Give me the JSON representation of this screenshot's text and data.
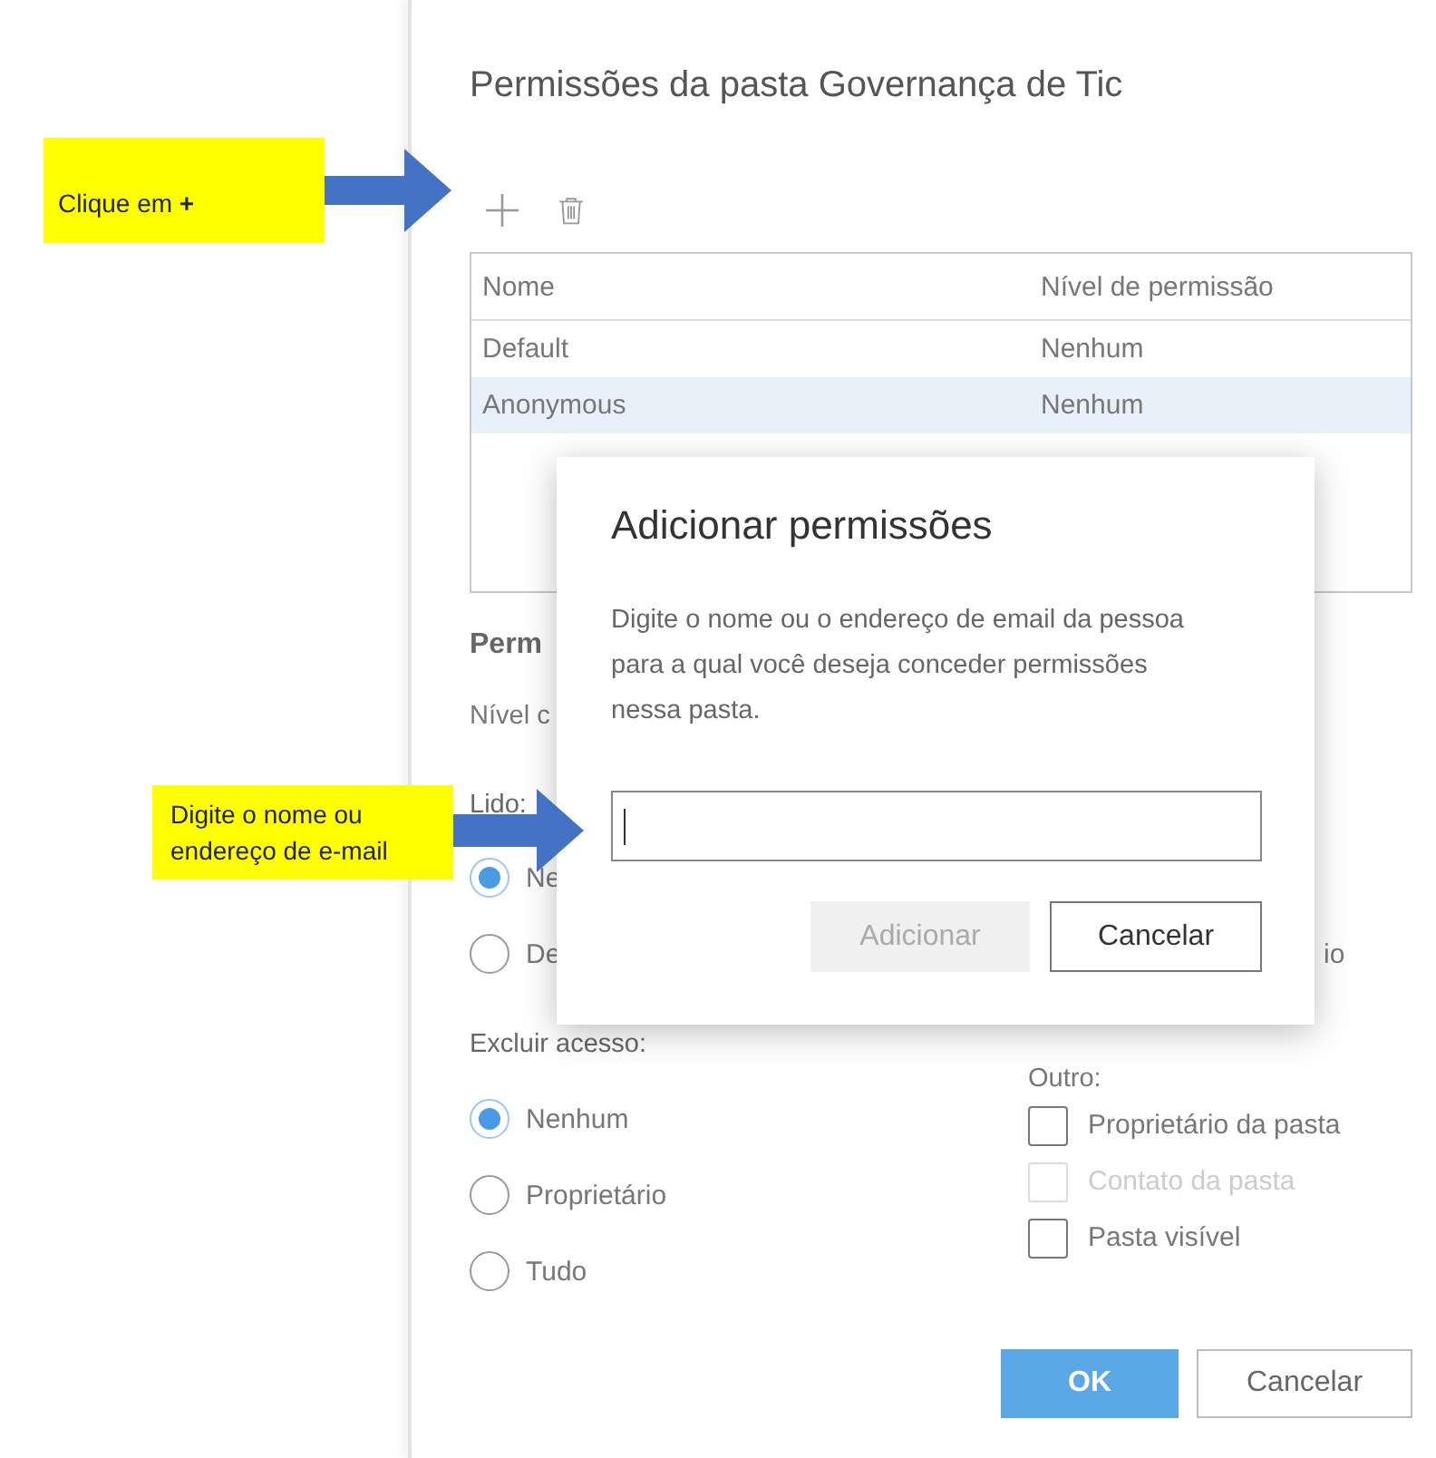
{
  "panel": {
    "title": "Permissões da pasta Governança de Tic",
    "table": {
      "columns": [
        "Nome",
        "Nível de permissão"
      ],
      "rows": [
        {
          "cells": [
            "Default",
            "Nenhum"
          ],
          "selected": false
        },
        {
          "cells": [
            "Anonymous",
            "Nenhum"
          ],
          "selected": true
        }
      ]
    },
    "section_heading": "Perm",
    "level_label": "Nível c",
    "read": {
      "label": "Lido:",
      "options": [
        {
          "label": "Ne",
          "selected": true
        },
        {
          "label": "De",
          "selected": false
        }
      ]
    },
    "right_fragment": "io",
    "delete_access": {
      "label": "Excluir acesso:",
      "options": [
        {
          "label": "Nenhum",
          "selected": true
        },
        {
          "label": "Proprietário",
          "selected": false
        },
        {
          "label": "Tudo",
          "selected": false
        }
      ]
    },
    "other": {
      "label": "Outro:",
      "options": [
        {
          "label": "Proprietário da pasta",
          "checked": false,
          "disabled": false
        },
        {
          "label": "Contato da pasta",
          "checked": false,
          "disabled": true
        },
        {
          "label": "Pasta visível",
          "checked": false,
          "disabled": false
        }
      ]
    },
    "buttons": [
      {
        "label": "OK",
        "kind": "primary"
      },
      {
        "label": "Cancelar",
        "kind": "default"
      }
    ]
  },
  "dialog": {
    "title": "Adicionar permissões",
    "description": "Digite o nome ou o endereço de email da pessoa para a qual você deseja conceder permissões nessa pasta.",
    "input": {
      "focused": true
    },
    "buttons": [
      {
        "label": "Adicionar",
        "disabled": true
      },
      {
        "label": "Cancelar",
        "disabled": false
      }
    ]
  },
  "callouts": [
    {
      "text": "Clique em **+**"
    },
    {
      "text": "Digite o nome ou\nendereço de e-mail"
    }
  ]
}
